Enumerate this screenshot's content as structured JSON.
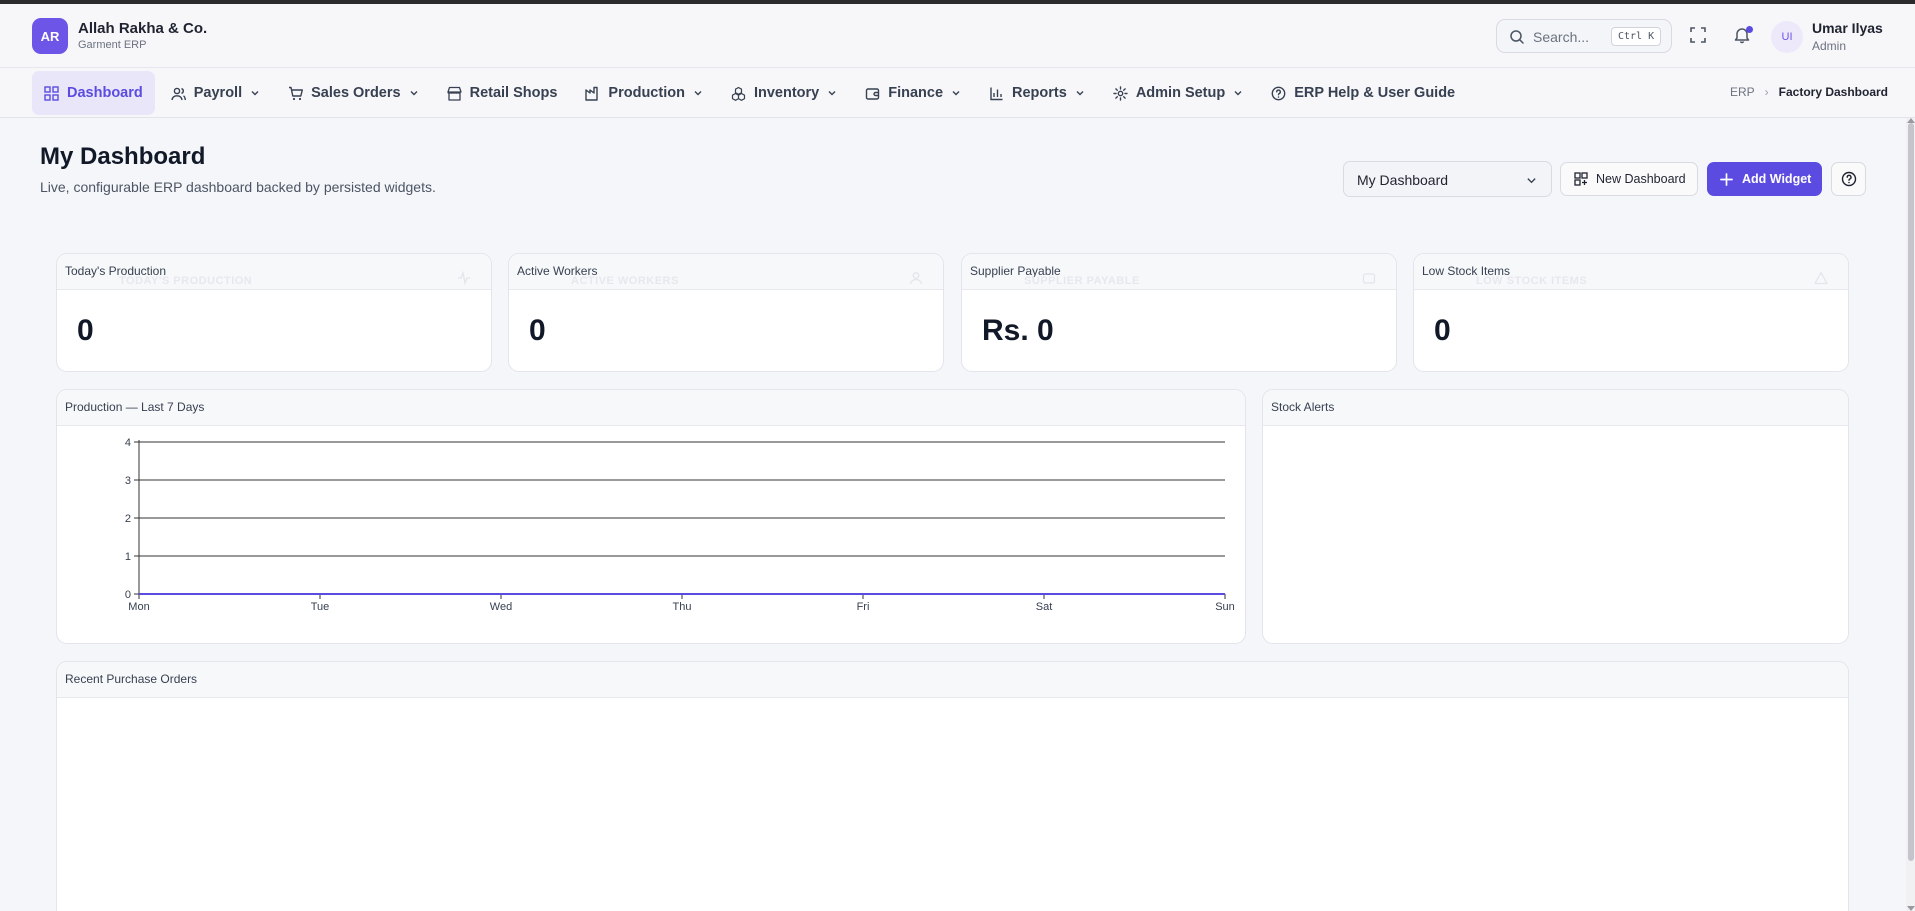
{
  "brand": {
    "logo_initials": "AR",
    "name": "Allah Rakha & Co.",
    "subtitle": "Garment ERP"
  },
  "header": {
    "search_placeholder": "Search...",
    "search_shortcut": "Ctrl K",
    "user": {
      "initials": "UI",
      "name": "Umar Ilyas",
      "role": "Admin"
    }
  },
  "nav": {
    "items": [
      {
        "label": "Dashboard",
        "icon": "grid-icon",
        "active": true,
        "has_dropdown": false
      },
      {
        "label": "Payroll",
        "icon": "users-icon",
        "has_dropdown": true
      },
      {
        "label": "Sales Orders",
        "icon": "cart-icon",
        "has_dropdown": true
      },
      {
        "label": "Retail Shops",
        "icon": "store-icon",
        "has_dropdown": false
      },
      {
        "label": "Production",
        "icon": "factory-icon",
        "has_dropdown": true
      },
      {
        "label": "Inventory",
        "icon": "boxes-icon",
        "has_dropdown": true
      },
      {
        "label": "Finance",
        "icon": "wallet-icon",
        "has_dropdown": true
      },
      {
        "label": "Reports",
        "icon": "bar-chart-icon",
        "has_dropdown": true
      },
      {
        "label": "Admin Setup",
        "icon": "gear-icon",
        "has_dropdown": true
      },
      {
        "label": "ERP Help & User Guide",
        "icon": "help-circle-icon",
        "has_dropdown": false
      }
    ],
    "breadcrumb": {
      "root": "ERP",
      "current": "Factory Dashboard"
    }
  },
  "page": {
    "title": "My Dashboard",
    "subtitle": "Live, configurable ERP dashboard backed by persisted widgets.",
    "dashboard_select": "My Dashboard",
    "new_dashboard_label": "New Dashboard",
    "add_widget_label": "Add Widget"
  },
  "kpis": [
    {
      "title": "Today's Production",
      "ghost": "TODAY'S PRODUCTION",
      "value": "0",
      "icon": "activity-icon"
    },
    {
      "title": "Active Workers",
      "ghost": "ACTIVE WORKERS",
      "value": "0",
      "icon": "user-icon"
    },
    {
      "title": "Supplier Payable",
      "ghost": "SUPPLIER PAYABLE",
      "value": "Rs. 0",
      "icon": "wallet-icon"
    },
    {
      "title": "Low Stock Items",
      "ghost": "LOW STOCK ITEMS",
      "value": "0",
      "icon": "alert-triangle-icon"
    }
  ],
  "widgets": {
    "production_title": "Production — Last 7 Days",
    "stock_alerts_title": "Stock Alerts",
    "recent_po_title": "Recent Purchase Orders"
  },
  "colors": {
    "accent": "#5b4be0",
    "line": "#5b4be0"
  },
  "chart_data": {
    "type": "line",
    "title": "Production — Last 7 Days",
    "categories": [
      "Mon",
      "Tue",
      "Wed",
      "Thu",
      "Fri",
      "Sat",
      "Sun"
    ],
    "series": [
      {
        "values": [
          0,
          0,
          0,
          0,
          0,
          0,
          0
        ]
      }
    ],
    "ylim": [
      0,
      4
    ],
    "yticks": [
      0,
      1,
      2,
      3,
      4
    ],
    "grid": true
  }
}
